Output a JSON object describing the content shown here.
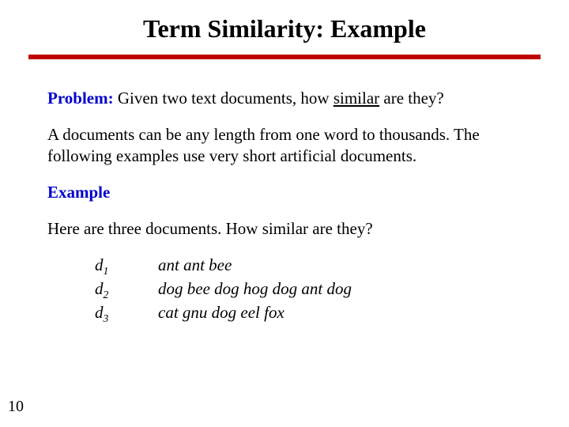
{
  "title": "Term Similarity: Example",
  "problem": {
    "label": "Problem:",
    "text_before": "Given two text documents, how ",
    "text_underlined": "similar",
    "text_after": " are they?"
  },
  "para1": "A documents can be any length from one word to thousands. The following examples use very short artificial documents.",
  "example_label": "Example",
  "question": "Here are three documents.  How similar are they?",
  "docs": [
    {
      "id_letter": "d",
      "id_sub": "1",
      "text": "ant ant bee"
    },
    {
      "id_letter": "d",
      "id_sub": "2",
      "text": "dog bee dog hog dog ant dog"
    },
    {
      "id_letter": "d",
      "id_sub": "3",
      "text": "cat gnu dog eel fox"
    }
  ],
  "page_number": "10",
  "colors": {
    "accent": "#c00000",
    "link": "#0000cc"
  }
}
